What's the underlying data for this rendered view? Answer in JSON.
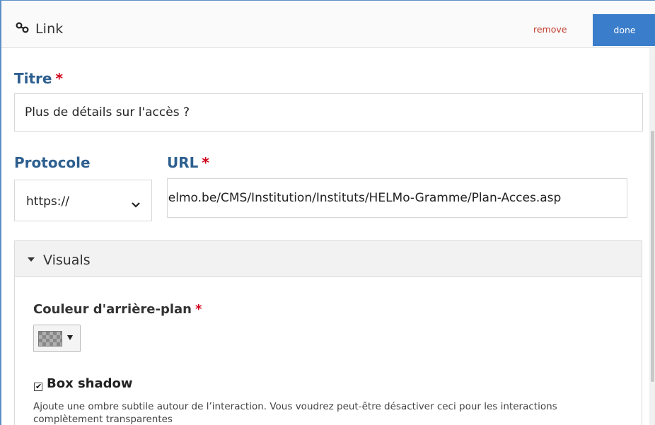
{
  "header": {
    "title": "Link",
    "remove_label": "remove",
    "done_label": "done"
  },
  "titre": {
    "label": "Titre",
    "required_mark": "*",
    "value": "Plus de détails sur l'accès ?"
  },
  "protocole": {
    "label": "Protocole",
    "selected": "https://"
  },
  "url": {
    "label": "URL",
    "required_mark": "*",
    "value": "helmo.be/CMS/Institution/Instituts/HELMo-Gramme/Plan-Acces.asp"
  },
  "visuals": {
    "label": "Visuals",
    "background_color": {
      "label": "Couleur d'arrière-plan",
      "required_mark": "*"
    },
    "box_shadow": {
      "label": "Box shadow",
      "checked": true,
      "help": "Ajoute une ombre subtile autour de l’interaction. Vous voudrez peut-être désactiver ceci pour les interactions complètement transparentes"
    }
  },
  "colors": {
    "accent": "#3a7dcb",
    "label_blue": "#2d5f8f",
    "required_red": "#d0021b",
    "remove_red": "#c0392b"
  },
  "icons": {
    "link": "link-icon",
    "chevron": "chevron-down-icon",
    "caret": "caret-down-icon",
    "checkbox": "checkbox-checked-icon"
  }
}
